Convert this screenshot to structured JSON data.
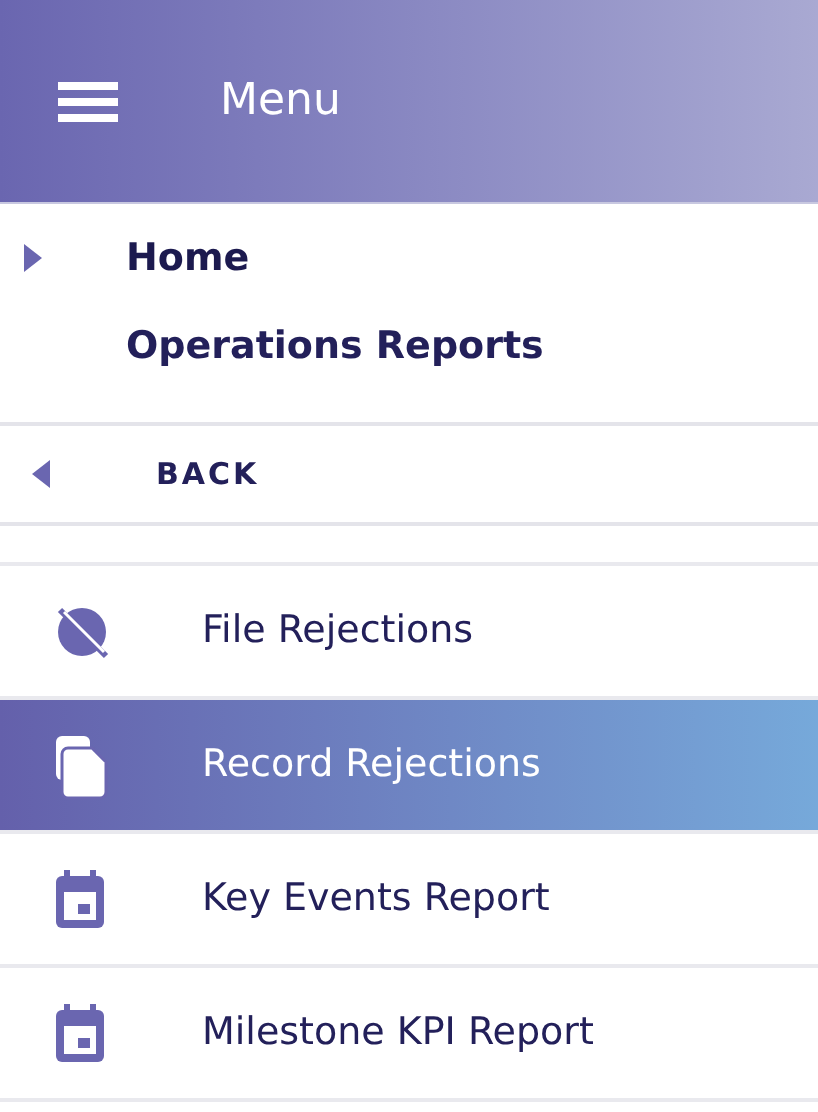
{
  "header": {
    "title": "Menu"
  },
  "breadcrumbs": [
    {
      "label": "Home",
      "selected": true
    },
    {
      "label": "Operations Reports",
      "selected": false
    }
  ],
  "back": {
    "label": "BACK"
  },
  "items": [
    {
      "label": "File Rejections",
      "kind": "blocked",
      "selected": false
    },
    {
      "label": "Record Rejections",
      "kind": "files",
      "selected": true
    },
    {
      "label": "Key Events Report",
      "kind": "calendar",
      "selected": false
    },
    {
      "label": "Milestone KPI Report",
      "kind": "calendar",
      "selected": false
    }
  ]
}
